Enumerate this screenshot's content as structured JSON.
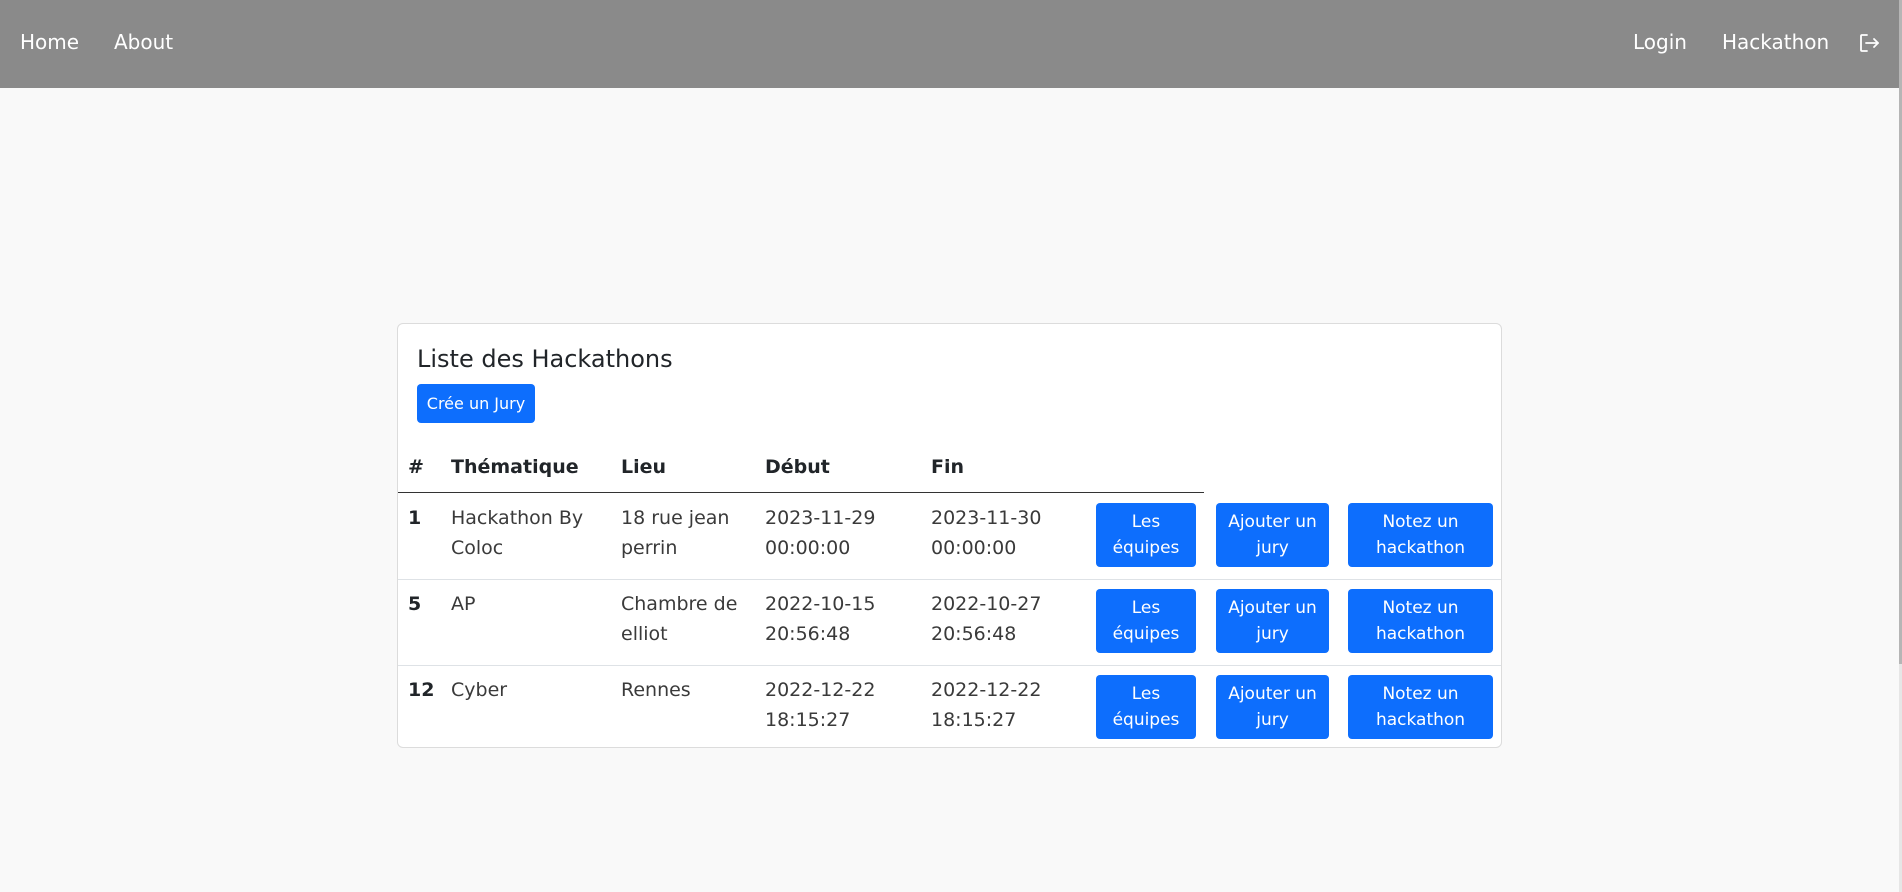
{
  "nav": {
    "home": "Home",
    "about": "About",
    "login": "Login",
    "hackathon": "Hackathon",
    "logout_icon": "logout-icon"
  },
  "card": {
    "title": "Liste des Hackathons",
    "create_button": "Crée un Jury"
  },
  "table": {
    "headers": [
      "#",
      "Thématique",
      "Lieu",
      "Début",
      "Fin"
    ],
    "rows": [
      {
        "id": "1",
        "thematique": "Hackathon By Coloc",
        "lieu": "18 rue jean perrin",
        "debut": "2023-11-29 00:00:00",
        "fin": "2023-11-30 00:00:00",
        "btn_equipes": "Les équipes",
        "btn_jury": "Ajouter un jury",
        "btn_note": "Notez un hackathon"
      },
      {
        "id": "5",
        "thematique": "AP",
        "lieu": "Chambre de elliot",
        "debut": "2022-10-15 20:56:48",
        "fin": "2022-10-27 20:56:48",
        "btn_equipes": "Les équipes",
        "btn_jury": "Ajouter un jury",
        "btn_note": "Notez un hackathon"
      },
      {
        "id": "12",
        "thematique": "Cyber",
        "lieu": "Rennes",
        "debut": "2022-12-22 18:15:27",
        "fin": "2022-12-22 18:15:27",
        "btn_equipes": "Les équipes",
        "btn_jury": "Ajouter un jury",
        "btn_note": "Notez un hackathon"
      }
    ]
  },
  "colors": {
    "navbar": "#8a8a8a",
    "primary": "#0d6efd",
    "background": "#f9f9f9"
  }
}
